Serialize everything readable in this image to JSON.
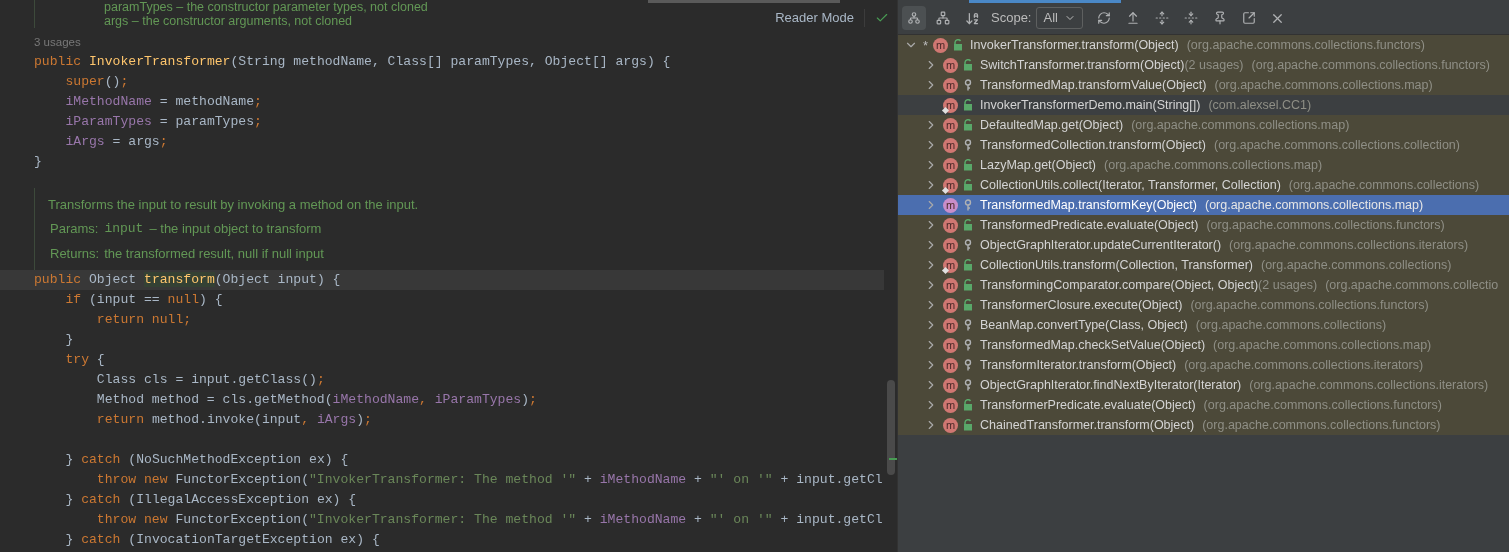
{
  "editor": {
    "reader_mode": "Reader Mode",
    "doc_top": [
      "paramTypes – the constructor parameter types, not cloned",
      "args – the constructor arguments, not cloned"
    ],
    "usages_hint": "3 usages",
    "constructor_lines": [
      {
        "kind": "code",
        "tokens": [
          {
            "kind": "keyword",
            "text": "public "
          },
          {
            "kind": "declaration",
            "text": "InvokerTransformer"
          },
          {
            "kind": "plain",
            "text": "(String methodName, Class[] paramTypes, Object[] args) {"
          }
        ]
      },
      {
        "kind": "code",
        "tokens": [
          {
            "kind": "keyword",
            "text": "    super"
          },
          {
            "kind": "plain",
            "text": "()"
          },
          {
            "kind": "keyword",
            "text": ";"
          }
        ]
      },
      {
        "kind": "code",
        "tokens": [
          {
            "kind": "field",
            "text": "    iMethodName"
          },
          {
            "kind": "plain",
            "text": " = methodName"
          },
          {
            "kind": "keyword",
            "text": ";"
          }
        ]
      },
      {
        "kind": "code",
        "tokens": [
          {
            "kind": "field",
            "text": "    iParamTypes"
          },
          {
            "kind": "plain",
            "text": " = paramTypes"
          },
          {
            "kind": "keyword",
            "text": ";"
          }
        ]
      },
      {
        "kind": "code",
        "tokens": [
          {
            "kind": "field",
            "text": "    iArgs"
          },
          {
            "kind": "plain",
            "text": " = args"
          },
          {
            "kind": "keyword",
            "text": ";"
          }
        ]
      },
      {
        "kind": "code",
        "tokens": [
          {
            "kind": "plain",
            "text": "}"
          }
        ]
      }
    ],
    "doc": {
      "summary": "Transforms the input to result by invoking a method on the input.",
      "params_label": "Params:",
      "params_code": "input",
      "params_text": "– the input object to transform",
      "returns_label": "Returns:",
      "returns_text": "the transformed result, null if null input"
    },
    "method_lines": [
      {
        "kind": "code",
        "current": true,
        "tokens": [
          {
            "kind": "keyword",
            "text": "public "
          },
          {
            "kind": "plain",
            "text": "Object "
          },
          {
            "kind": "usage",
            "text": "transform"
          },
          {
            "kind": "plain",
            "text": "(Object input) {"
          }
        ]
      },
      {
        "kind": "code",
        "tokens": [
          {
            "kind": "keyword",
            "text": "    if"
          },
          {
            "kind": "plain",
            "text": " (input == "
          },
          {
            "kind": "keyword",
            "text": "null"
          },
          {
            "kind": "plain",
            "text": ") {"
          }
        ]
      },
      {
        "kind": "code",
        "tokens": [
          {
            "kind": "keyword",
            "text": "        return null;"
          }
        ]
      },
      {
        "kind": "code",
        "tokens": [
          {
            "kind": "plain",
            "text": "    }"
          }
        ]
      },
      {
        "kind": "code",
        "tokens": [
          {
            "kind": "keyword",
            "text": "    try"
          },
          {
            "kind": "plain",
            "text": " {"
          }
        ]
      },
      {
        "kind": "code",
        "tokens": [
          {
            "kind": "plain",
            "text": "        Class cls = input.getClass()"
          },
          {
            "kind": "keyword",
            "text": ";"
          }
        ]
      },
      {
        "kind": "code",
        "tokens": [
          {
            "kind": "plain",
            "text": "        Method method = cls.getMethod("
          },
          {
            "kind": "field",
            "text": "iMethodName"
          },
          {
            "kind": "keyword",
            "text": ", "
          },
          {
            "kind": "field",
            "text": "iParamTypes"
          },
          {
            "kind": "plain",
            "text": ")"
          },
          {
            "kind": "keyword",
            "text": ";"
          }
        ]
      },
      {
        "kind": "code",
        "tokens": [
          {
            "kind": "keyword",
            "text": "        return "
          },
          {
            "kind": "plain",
            "text": "method.invoke(input"
          },
          {
            "kind": "keyword",
            "text": ", "
          },
          {
            "kind": "field",
            "text": "iArgs"
          },
          {
            "kind": "plain",
            "text": ")"
          },
          {
            "kind": "keyword",
            "text": ";"
          }
        ]
      },
      {
        "kind": "blank"
      },
      {
        "kind": "code",
        "tokens": [
          {
            "kind": "plain",
            "text": "    } "
          },
          {
            "kind": "keyword",
            "text": "catch"
          },
          {
            "kind": "plain",
            "text": " (NoSuchMethodException ex) {"
          }
        ]
      },
      {
        "kind": "code",
        "tokens": [
          {
            "kind": "keyword",
            "text": "        throw new "
          },
          {
            "kind": "plain",
            "text": "FunctorException("
          },
          {
            "kind": "string",
            "text": "\"InvokerTransformer: The method '\""
          },
          {
            "kind": "plain",
            "text": " + "
          },
          {
            "kind": "field",
            "text": "iMethodName"
          },
          {
            "kind": "plain",
            "text": " + "
          },
          {
            "kind": "string",
            "text": "\"' on '\""
          },
          {
            "kind": "plain",
            "text": " + input.getCl"
          }
        ]
      },
      {
        "kind": "code",
        "tokens": [
          {
            "kind": "plain",
            "text": "    } "
          },
          {
            "kind": "keyword",
            "text": "catch"
          },
          {
            "kind": "plain",
            "text": " (IllegalAccessException ex) {"
          }
        ]
      },
      {
        "kind": "code",
        "tokens": [
          {
            "kind": "keyword",
            "text": "        throw new "
          },
          {
            "kind": "plain",
            "text": "FunctorException("
          },
          {
            "kind": "string",
            "text": "\"InvokerTransformer: The method '\""
          },
          {
            "kind": "plain",
            "text": " + "
          },
          {
            "kind": "field",
            "text": "iMethodName"
          },
          {
            "kind": "plain",
            "text": " + "
          },
          {
            "kind": "string",
            "text": "\"' on '\""
          },
          {
            "kind": "plain",
            "text": " + input.getCl"
          }
        ]
      },
      {
        "kind": "code",
        "tokens": [
          {
            "kind": "plain",
            "text": "    } "
          },
          {
            "kind": "keyword",
            "text": "catch"
          },
          {
            "kind": "plain",
            "text": " (InvocationTargetException ex) {"
          }
        ]
      }
    ]
  },
  "hierarchy": {
    "scope_label": "Scope:",
    "scope_value": "All",
    "root": {
      "star": "*",
      "icon": "m",
      "name": "InvokerTransformer.transform(Object)",
      "package": "(org.apache.commons.collections.functors)",
      "expanded": true,
      "kind": "public",
      "overridden": false,
      "selected": false,
      "highlighted": false
    },
    "callers": [
      {
        "icon": "m",
        "name": "SwitchTransformer.transform(Object)",
        "usages": "(2 usages)",
        "package": "(org.apache.commons.collections.functors)",
        "expandable": true,
        "kind": "public",
        "overridden": false,
        "selected": false,
        "highlighted": false
      },
      {
        "icon": "m",
        "name": "TransformedMap.transformValue(Object)",
        "package": "(org.apache.commons.collections.map)",
        "expandable": true,
        "kind": "protected",
        "overridden": false,
        "selected": false,
        "highlighted": false
      },
      {
        "icon": "m",
        "name": "InvokerTransformerDemo.main(String[])",
        "package": "(com.alexsel.CC1)",
        "expandable": false,
        "kind": "public",
        "overridden": true,
        "selected": false,
        "highlighted": true
      },
      {
        "icon": "m",
        "name": "DefaultedMap.get(Object)",
        "package": "(org.apache.commons.collections.map)",
        "expandable": true,
        "kind": "public",
        "overridden": false,
        "selected": false,
        "highlighted": false
      },
      {
        "icon": "m",
        "name": "TransformedCollection.transform(Object)",
        "package": "(org.apache.commons.collections.collection)",
        "expandable": true,
        "kind": "protected",
        "overridden": false,
        "selected": false,
        "highlighted": false
      },
      {
        "icon": "m",
        "name": "LazyMap.get(Object)",
        "package": "(org.apache.commons.collections.map)",
        "expandable": true,
        "kind": "public",
        "overridden": false,
        "selected": false,
        "highlighted": false
      },
      {
        "icon": "m",
        "name": "CollectionUtils.collect(Iterator, Transformer, Collection)",
        "package": "(org.apache.commons.collections)",
        "expandable": true,
        "kind": "public",
        "overridden": true,
        "selected": false,
        "highlighted": false
      },
      {
        "icon": "m",
        "name": "TransformedMap.transformKey(Object)",
        "package": "(org.apache.commons.collections.map)",
        "expandable": true,
        "kind": "protected",
        "overridden": false,
        "selected": true,
        "highlighted": false
      },
      {
        "icon": "m",
        "name": "TransformedPredicate.evaluate(Object)",
        "package": "(org.apache.commons.collections.functors)",
        "expandable": true,
        "kind": "public",
        "overridden": false,
        "selected": false,
        "highlighted": false
      },
      {
        "icon": "m",
        "name": "ObjectGraphIterator.updateCurrentIterator()",
        "package": "(org.apache.commons.collections.iterators)",
        "expandable": true,
        "kind": "protected",
        "overridden": false,
        "selected": false,
        "highlighted": false
      },
      {
        "icon": "m",
        "name": "CollectionUtils.transform(Collection, Transformer)",
        "package": "(org.apache.commons.collections)",
        "expandable": true,
        "kind": "public",
        "overridden": true,
        "selected": false,
        "highlighted": false
      },
      {
        "icon": "m",
        "name": "TransformingComparator.compare(Object, Object)",
        "usages": "(2 usages)",
        "package": "(org.apache.commons.collectio",
        "expandable": true,
        "kind": "public",
        "overridden": false,
        "selected": false,
        "highlighted": false
      },
      {
        "icon": "m",
        "name": "TransformerClosure.execute(Object)",
        "package": "(org.apache.commons.collections.functors)",
        "expandable": true,
        "kind": "public",
        "overridden": false,
        "selected": false,
        "highlighted": false
      },
      {
        "icon": "m",
        "name": "BeanMap.convertType(Class, Object)",
        "package": "(org.apache.commons.collections)",
        "expandable": true,
        "kind": "protected",
        "overridden": false,
        "selected": false,
        "highlighted": false
      },
      {
        "icon": "m",
        "name": "TransformedMap.checkSetValue(Object)",
        "package": "(org.apache.commons.collections.map)",
        "expandable": true,
        "kind": "protected",
        "overridden": false,
        "selected": false,
        "highlighted": false
      },
      {
        "icon": "m",
        "name": "TransformIterator.transform(Object)",
        "package": "(org.apache.commons.collections.iterators)",
        "expandable": true,
        "kind": "protected",
        "overridden": false,
        "selected": false,
        "highlighted": false
      },
      {
        "icon": "m",
        "name": "ObjectGraphIterator.findNextByIterator(Iterator)",
        "package": "(org.apache.commons.collections.iterators)",
        "expandable": true,
        "kind": "protected",
        "overridden": false,
        "selected": false,
        "highlighted": false
      },
      {
        "icon": "m",
        "name": "TransformerPredicate.evaluate(Object)",
        "package": "(org.apache.commons.collections.functors)",
        "expandable": true,
        "kind": "public",
        "overridden": false,
        "selected": false,
        "highlighted": false
      },
      {
        "icon": "m",
        "name": "ChainedTransformer.transform(Object)",
        "package": "(org.apache.commons.collections.functors)",
        "expandable": true,
        "kind": "public",
        "overridden": false,
        "selected": false,
        "highlighted": false
      }
    ]
  }
}
